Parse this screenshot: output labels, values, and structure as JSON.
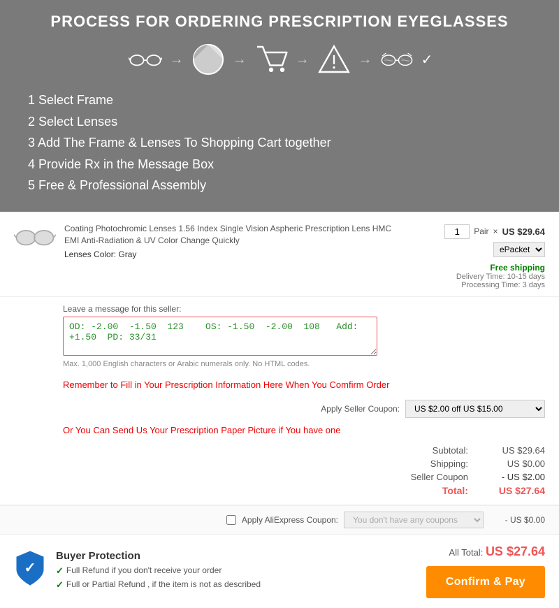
{
  "banner": {
    "title": "PROCESS FOR ORDERING PRESCRIPTION EYEGLASSES",
    "steps": [
      "1 Select Frame",
      "2 Select Lenses",
      "3 Add The Frame & Lenses To Shopping Cart together",
      "4 Provide Rx in the Message Box",
      "5 Free & Professional Assembly"
    ]
  },
  "product": {
    "name": "Coating Photochromic Lenses 1.56 Index Single Vision Aspheric Prescription Lens HMC EMI Anti-Radiation & UV Color Change Quickly",
    "lens_color_label": "Lenses Color:",
    "lens_color_value": "Gray",
    "qty": "1",
    "pair": "Pair",
    "price": "US $29.64",
    "shipping_method": "ePacket",
    "free_shipping": "Free shipping",
    "delivery_label": "Delivery Time: 10-15 days",
    "processing_label": "Processing Time: 3 days"
  },
  "message": {
    "label": "Leave a message for this seller:",
    "value": "OD: -2.00  -1.50  123    OS: -1.50  -2.00  108   Add: +1.50  PD: 33/31",
    "hint": "Max. 1,000 English characters or Arabic numerals only. No HTML codes."
  },
  "reminder": "Remember to Fill in Your Prescription Information Here When You Comfirm Order",
  "or_send": "Or You Can Send Us Your Prescription Paper Picture if You have one",
  "coupon": {
    "label": "Apply Seller Coupon:",
    "value": "US $2.00 off US $15.00"
  },
  "totals": {
    "subtotal_label": "Subtotal:",
    "subtotal_value": "US $29.64",
    "shipping_label": "Shipping:",
    "shipping_value": "US $0.00",
    "seller_coupon_label": "Seller Coupon",
    "seller_coupon_value": "- US $2.00",
    "total_label": "Total:",
    "total_value": "US $27.64"
  },
  "aliexpress_coupon": {
    "label": "Apply AliExpress Coupon:",
    "placeholder": "You don't have any coupons",
    "discount": "- US $0.00"
  },
  "bottom": {
    "protection_title": "Buyer Protection",
    "protection_items": [
      "Full Refund if you don't receive your order",
      "Full or Partial Refund , if the item is not as described"
    ],
    "all_total_label": "All Total:",
    "all_total_value": "US $27.64",
    "confirm_label": "Confirm & Pay"
  }
}
